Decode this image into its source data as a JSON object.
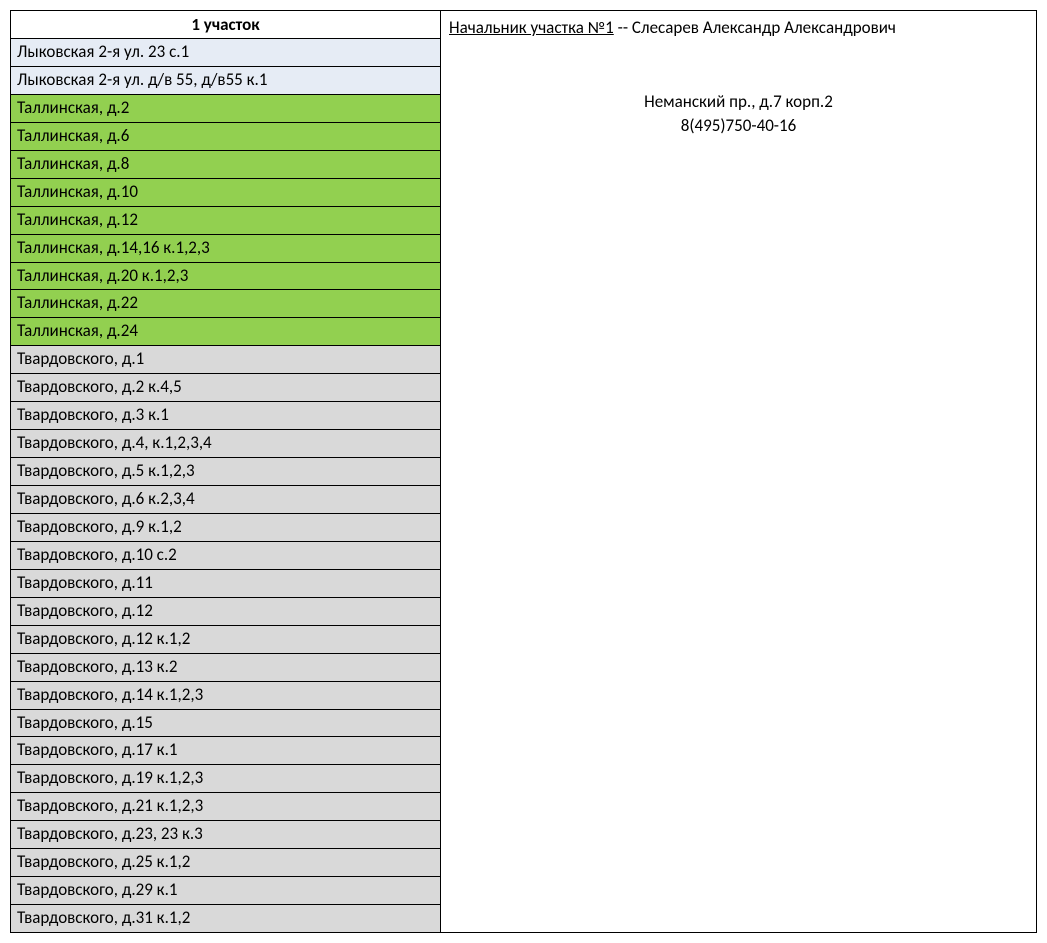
{
  "leftColumn": {
    "header": "1 участок",
    "rows": [
      {
        "text": "Лыковская 2-я ул. 23 с.1",
        "bg": "lightblue"
      },
      {
        "text": "Лыковская 2-я ул. д/в 55, д/в55 к.1",
        "bg": "lightblue"
      },
      {
        "text": "Таллинская, д.2",
        "bg": "green"
      },
      {
        "text": "Таллинская, д.6",
        "bg": "green"
      },
      {
        "text": "Таллинская, д.8",
        "bg": "green"
      },
      {
        "text": "Таллинская, д.10",
        "bg": "green"
      },
      {
        "text": "Таллинская, д.12",
        "bg": "green"
      },
      {
        "text": "Таллинская, д.14,16 к.1,2,3",
        "bg": "green"
      },
      {
        "text": "Таллинская, д.20 к.1,2,3",
        "bg": "green"
      },
      {
        "text": "Таллинская, д.22",
        "bg": "green"
      },
      {
        "text": "Таллинская, д.24",
        "bg": "green"
      },
      {
        "text": "Твардовского, д.1",
        "bg": "gray"
      },
      {
        "text": "Твардовского, д.2 к.4,5",
        "bg": "gray"
      },
      {
        "text": "Твардовского, д.3 к.1",
        "bg": "gray"
      },
      {
        "text": "Твардовского, д.4, к.1,2,3,4",
        "bg": "gray"
      },
      {
        "text": "Твардовского, д.5 к.1,2,3",
        "bg": "gray"
      },
      {
        "text": "Твардовского, д.6 к.2,3,4",
        "bg": "gray"
      },
      {
        "text": "Твардовского, д.9 к.1,2",
        "bg": "gray"
      },
      {
        "text": "Твардовского, д.10 с.2",
        "bg": "gray"
      },
      {
        "text": "Твардовского, д.11",
        "bg": "gray"
      },
      {
        "text": "Твардовского, д.12",
        "bg": "gray"
      },
      {
        "text": "Твардовского, д.12 к.1,2",
        "bg": "gray"
      },
      {
        "text": "Твардовского, д.13 к.2",
        "bg": "gray"
      },
      {
        "text": "Твардовского, д.14 к.1,2,3",
        "bg": "gray"
      },
      {
        "text": "Твардовского, д.15",
        "bg": "gray"
      },
      {
        "text": "Твардовского, д.17 к.1",
        "bg": "gray"
      },
      {
        "text": "Твардовского, д.19 к.1,2,3",
        "bg": "gray"
      },
      {
        "text": "Твардовского, д.21 к.1,2,3",
        "bg": "gray"
      },
      {
        "text": "Твардовского, д.23, 23 к.3",
        "bg": "gray"
      },
      {
        "text": "Твардовского, д.25 к.1,2",
        "bg": "gray"
      },
      {
        "text": "Твардовского, д.29 к.1",
        "bg": "gray"
      },
      {
        "text": "Твардовского, д.31 к.1,2",
        "bg": "gray"
      }
    ]
  },
  "rightColumn": {
    "titleUnderlined": "Начальник участка №1",
    "titleRest": " -- Слесарев Александр Александрович",
    "address": "Неманский пр., д.7 корп.2",
    "phone": "8(495)750-40-16"
  }
}
